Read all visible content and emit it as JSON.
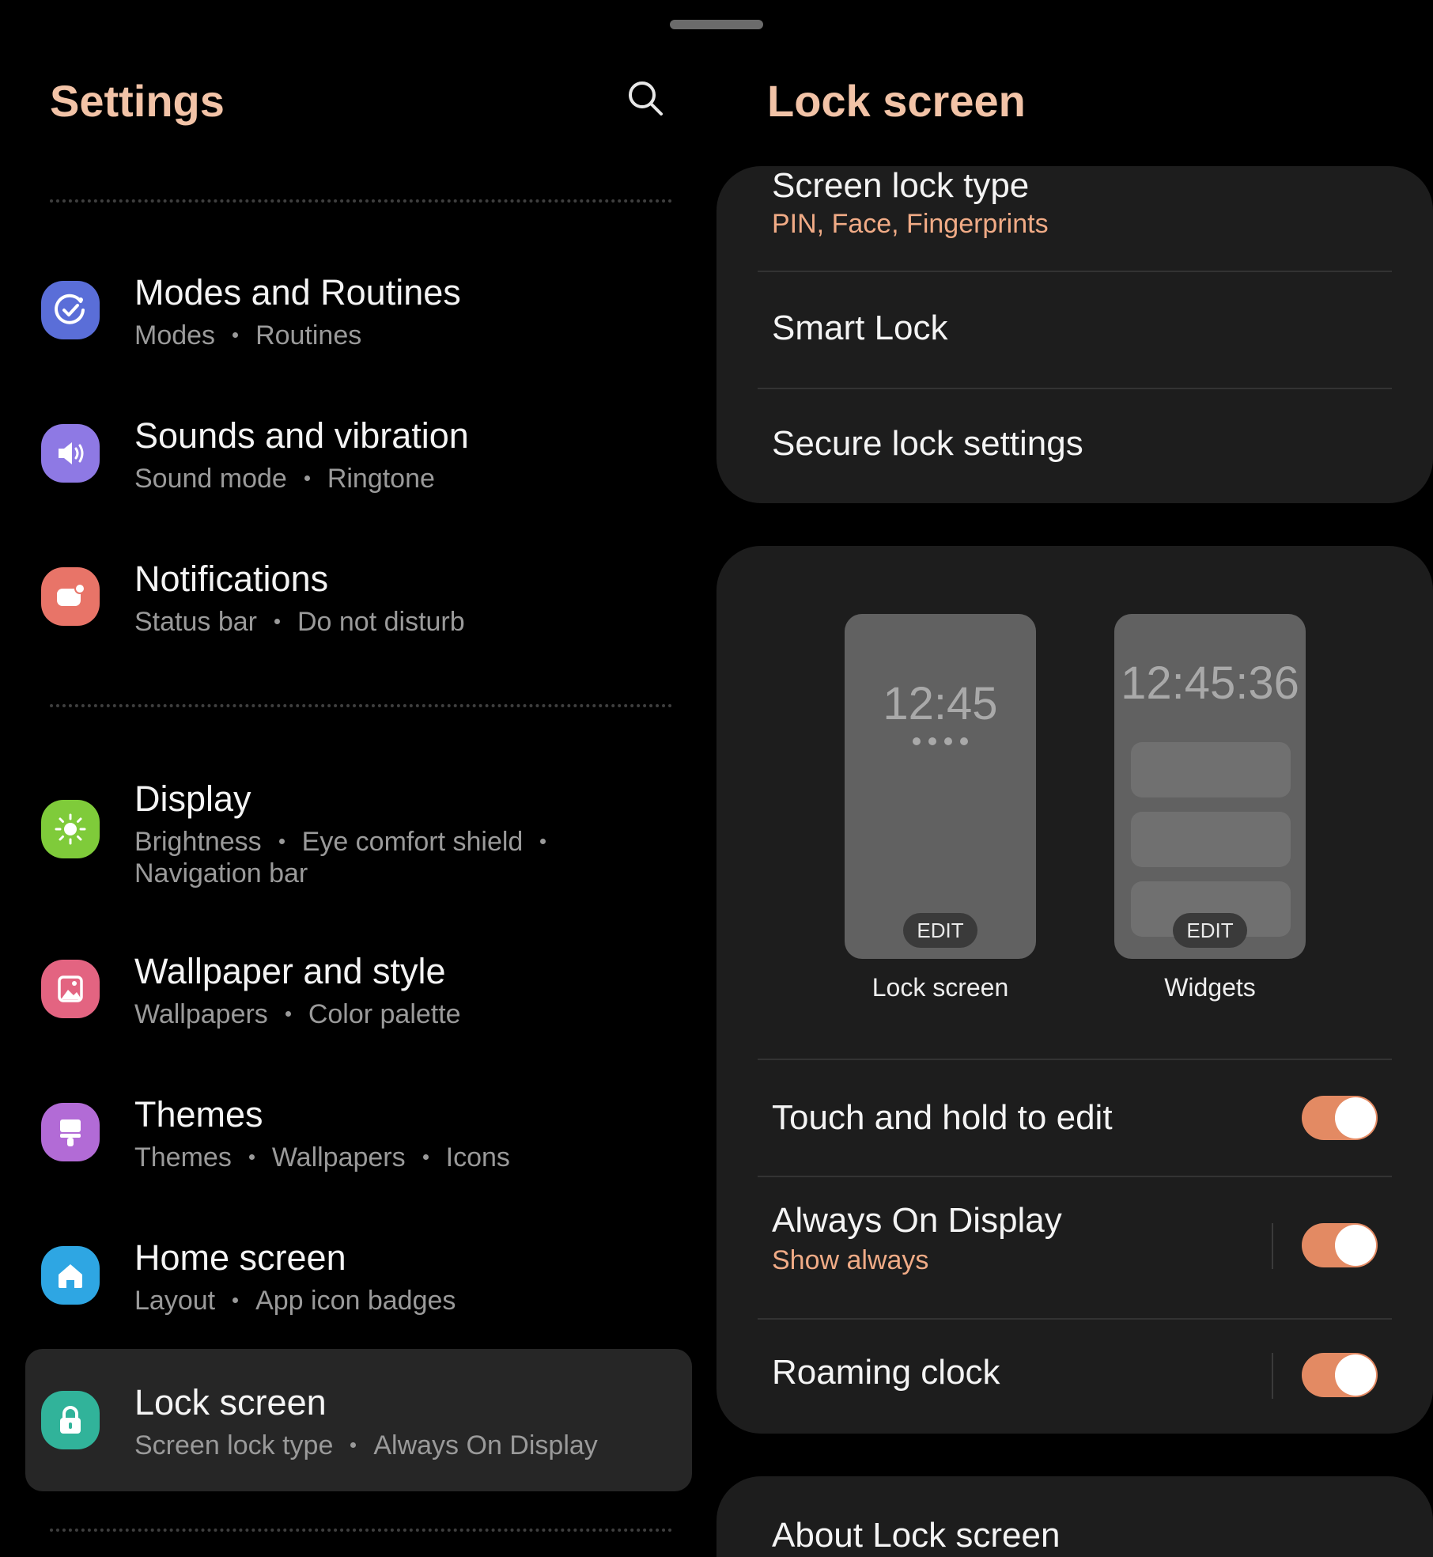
{
  "settings": {
    "title": "Settings",
    "search_icon": "search-icon",
    "items": [
      {
        "title": "Modes and Routines",
        "sub": [
          "Modes",
          "Routines"
        ],
        "icon": "modes-routines-icon",
        "color": "#5a6ed8"
      },
      {
        "title": "Sounds and vibration",
        "sub": [
          "Sound mode",
          "Ringtone"
        ],
        "icon": "speaker-icon",
        "color": "#8e79e4"
      },
      {
        "title": "Notifications",
        "sub": [
          "Status bar",
          "Do not disturb"
        ],
        "icon": "notification-icon",
        "color": "#e87468"
      },
      {
        "title": "Display",
        "sub": [
          "Brightness",
          "Eye comfort shield"
        ],
        "sub2": "Navigation bar",
        "icon": "sun-icon",
        "color": "#7fcb3a"
      },
      {
        "title": "Wallpaper and style",
        "sub": [
          "Wallpapers",
          "Color palette"
        ],
        "icon": "wallpaper-icon",
        "color": "#e36481"
      },
      {
        "title": "Themes",
        "sub": [
          "Themes",
          "Wallpapers",
          "Icons"
        ],
        "icon": "brush-icon",
        "color": "#b26bd6"
      },
      {
        "title": "Home screen",
        "sub": [
          "Layout",
          "App icon badges"
        ],
        "icon": "home-icon",
        "color": "#2ea6e3"
      },
      {
        "title": "Lock screen",
        "sub": [
          "Screen lock type",
          "Always On Display"
        ],
        "icon": "lock-icon",
        "color": "#31b39a",
        "selected": true
      }
    ]
  },
  "lock_screen": {
    "title": "Lock screen",
    "screen_lock_type": {
      "title": "Screen lock type",
      "value": "PIN, Face, Fingerprints"
    },
    "smart_lock": "Smart Lock",
    "secure_lock_settings": "Secure lock settings",
    "previews": {
      "lock": {
        "time": "12:45",
        "edit": "EDIT",
        "label": "Lock screen"
      },
      "widgets": {
        "time": "12:45:36",
        "edit": "EDIT",
        "label": "Widgets"
      }
    },
    "touch_hold": {
      "title": "Touch and hold to edit",
      "on": true
    },
    "aod": {
      "title": "Always On Display",
      "value": "Show always",
      "on": true
    },
    "roaming_clock": {
      "title": "Roaming clock",
      "on": true
    },
    "about": "About Lock screen",
    "accent_color": "#f0ab86"
  }
}
